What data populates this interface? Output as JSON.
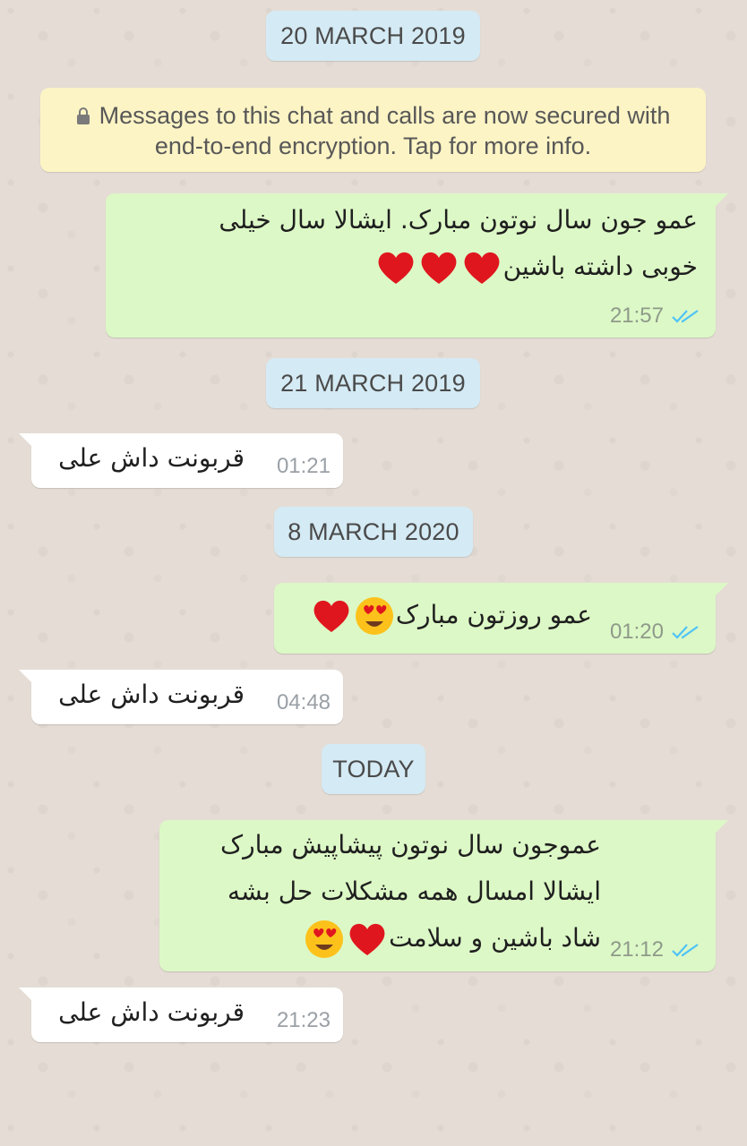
{
  "dates": {
    "d1": "20 MARCH 2019",
    "d2": "21 MARCH 2019",
    "d3": "8 MARCH 2020",
    "d4": "TODAY"
  },
  "encryption_notice": {
    "line1": "Messages to this chat and calls are now secured with",
    "line2": "end-to-end encryption. Tap for more info."
  },
  "messages": [
    {
      "direction": "outgoing",
      "lines": [
        "عمو جون سال نوتون مبارک. ایشالا سال خیلی",
        "خوبی داشته باشین"
      ],
      "emoji": [
        "red-heart",
        "red-heart",
        "red-heart"
      ],
      "time": "21:57",
      "status": "read"
    },
    {
      "direction": "incoming",
      "lines": [
        "قربونت داش علی"
      ],
      "time": "01:21"
    },
    {
      "direction": "outgoing",
      "lines": [
        "عمو روزتون مبارک"
      ],
      "emoji": [
        "heart-eyes",
        "red-heart"
      ],
      "time": "01:20",
      "status": "read"
    },
    {
      "direction": "incoming",
      "lines": [
        "قربونت داش علی"
      ],
      "time": "04:48"
    },
    {
      "direction": "outgoing",
      "lines": [
        "عموجون سال نوتون پیشاپیش مبارک",
        "ایشالا امسال همه مشکلات حل بشه",
        "شاد باشین و سلامت"
      ],
      "emoji": [
        "red-heart",
        "heart-eyes"
      ],
      "time": "21:12",
      "status": "read"
    },
    {
      "direction": "incoming",
      "lines": [
        "قربونت داش علی"
      ],
      "time": "21:23"
    }
  ],
  "colors": {
    "wallpaper": "#e5ddd5",
    "outgoing_bubble": "#dcf8c6",
    "incoming_bubble": "#ffffff",
    "date_chip": "#d4eaf4",
    "system_banner": "#fdf4c5",
    "read_ticks": "#4fc3f7"
  }
}
